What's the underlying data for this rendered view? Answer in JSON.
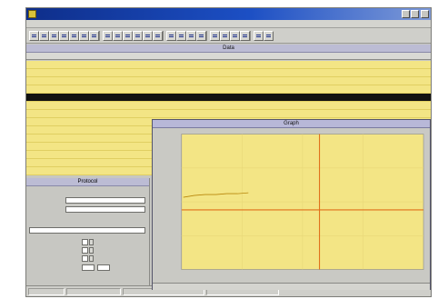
{
  "window": {
    "title": "",
    "controls": [
      "minimize-icon",
      "maximize-icon",
      "close-icon"
    ],
    "title_gradient": [
      "#0e2e8a",
      "#7e9ad8"
    ]
  },
  "menu": [
    "",
    "",
    "",
    "",
    "",
    "",
    ""
  ],
  "toolbar": {
    "buttons": [
      "",
      "",
      "",
      "",
      "",
      "",
      "",
      "",
      "",
      "",
      "",
      "",
      "",
      "",
      "",
      "",
      "",
      "",
      "",
      "",
      "",
      "",
      ""
    ]
  },
  "data_panel": {
    "title": "Data",
    "columns": [
      "",
      "",
      "",
      "",
      "",
      "",
      "",
      "",
      "",
      "",
      "",
      "",
      ""
    ],
    "rows": [
      [
        "",
        "",
        "",
        "",
        "",
        "",
        "",
        "",
        "",
        "",
        "",
        "",
        ""
      ],
      [
        "",
        "",
        "",
        "",
        "",
        "",
        "",
        "",
        "",
        "",
        "",
        "",
        ""
      ],
      [
        "",
        "",
        "",
        "",
        "",
        "",
        "",
        "",
        "",
        "",
        "",
        "",
        ""
      ],
      [
        "",
        "",
        "",
        "",
        "",
        "",
        "",
        "",
        "",
        "",
        "",
        "",
        ""
      ],
      [
        "",
        "",
        "",
        "",
        "",
        "",
        "",
        "",
        "",
        "",
        "",
        "",
        ""
      ],
      [
        "",
        "",
        "",
        "",
        "",
        "",
        "",
        "",
        "",
        "",
        "",
        "",
        ""
      ],
      [
        "",
        "",
        "",
        "",
        "",
        "",
        "",
        "",
        "",
        "",
        "",
        "",
        ""
      ],
      [
        "",
        "",
        "",
        "",
        "",
        "",
        "",
        "",
        "",
        "",
        "",
        "",
        ""
      ],
      [
        "",
        "",
        "",
        "",
        "",
        "",
        "",
        "",
        "",
        "",
        "",
        "",
        ""
      ],
      [
        "",
        "",
        "",
        "",
        "",
        "",
        "",
        "",
        "",
        "",
        "",
        "",
        ""
      ],
      [
        "",
        "",
        "",
        "",
        "",
        "",
        "",
        "",
        "",
        "",
        "",
        "",
        ""
      ],
      [
        "",
        "",
        "",
        "",
        "",
        "",
        "",
        "",
        "",
        "",
        "",
        "",
        ""
      ],
      [
        "",
        "",
        "",
        "",
        "",
        "",
        "",
        "",
        "",
        "",
        "",
        "",
        ""
      ],
      [
        "",
        "",
        "",
        "",
        "",
        "",
        "",
        "",
        "",
        "",
        "",
        "",
        ""
      ]
    ],
    "selected_row": 4,
    "row_color": "#f3e585",
    "selected_color": "#111111"
  },
  "protocol": {
    "title": "Protocol",
    "section1": "",
    "description_label": "",
    "description_value": "",
    "location_label": "",
    "location_value": "",
    "section2": "",
    "comment_label": "",
    "comment_value": "",
    "temperature_label": "",
    "temperature_value": "",
    "vpressure_label": "",
    "vpressure_value": "",
    "humidity_label": "",
    "humidity_value": "",
    "rollover_label": "",
    "rollover_value": ""
  },
  "graph": {
    "title": "Graph",
    "y_axis_label": "",
    "x_axis_label": "",
    "y_marker_label": "",
    "x_ticks": [
      "",
      "",
      "",
      ""
    ],
    "plot_background": "#f3e585",
    "cursor_color": "#e0701a",
    "trace_color": "#b8860b",
    "y_cursor_fraction": 0.56,
    "x_cursor_fraction": 0.57
  },
  "status": {
    "segments": [
      "",
      "",
      "",
      ""
    ]
  }
}
